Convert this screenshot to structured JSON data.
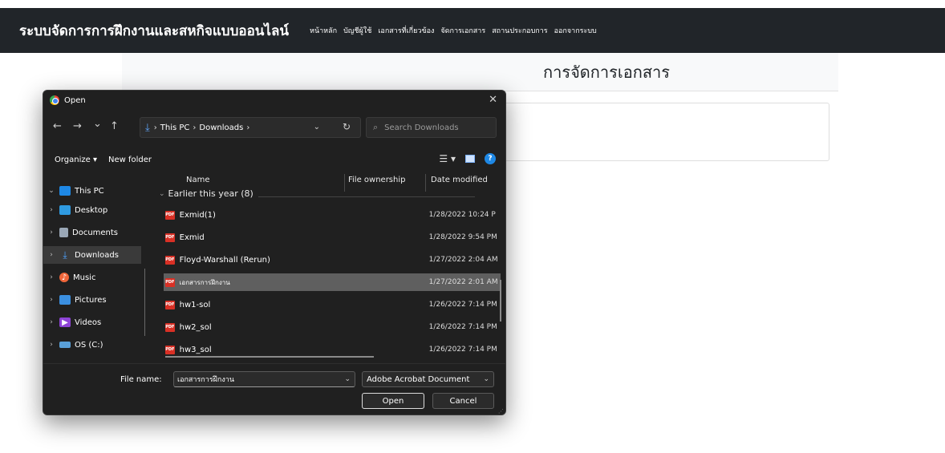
{
  "site": {
    "brand": "ระบบจัดการการฝึกงานและสหกิจแบบออนไลน์",
    "nav": [
      "หน้าหลัก",
      "บัญชีผู้ใช้",
      "เอกสารที่เกี่ยวข้อง",
      "จัดการเอกสาร",
      "สถานประกอบการ",
      "ออกจากระบบ"
    ],
    "page_title": "การจัดการเอกสาร"
  },
  "dialog": {
    "title": "Open",
    "back": "←",
    "forward": "→",
    "recent": "⌄",
    "up": "↑",
    "breadcrumb": [
      "This PC",
      "Downloads"
    ],
    "search_placeholder": "Search Downloads",
    "toolbar": {
      "organize": "Organize ▾",
      "new_folder": "New folder"
    },
    "nav_items": [
      {
        "label": "This PC",
        "icon": "pc-icon",
        "expanded": true
      },
      {
        "label": "Desktop",
        "icon": "desktop-icon"
      },
      {
        "label": "Documents",
        "icon": "documents-icon"
      },
      {
        "label": "Downloads",
        "icon": "download-icon",
        "selected": true
      },
      {
        "label": "Music",
        "icon": "music-icon"
      },
      {
        "label": "Pictures",
        "icon": "pictures-icon"
      },
      {
        "label": "Videos",
        "icon": "videos-icon"
      },
      {
        "label": "OS (C:)",
        "icon": "drive-icon"
      }
    ],
    "columns": {
      "name": "Name",
      "ownership": "File ownership",
      "modified": "Date modified"
    },
    "group": "Earlier this year (8)",
    "files": [
      {
        "name": "Exmid(1)",
        "date": "1/28/2022 10:24 P"
      },
      {
        "name": "Exmid",
        "date": "1/28/2022 9:54 PM"
      },
      {
        "name": "Floyd-Warshall (Rerun)",
        "date": "1/27/2022 2:04 AM"
      },
      {
        "name": "เอกสารการฝึกงาน",
        "date": "1/27/2022 2:01 AM",
        "selected": true
      },
      {
        "name": "hw1-sol",
        "date": "1/26/2022 7:14 PM"
      },
      {
        "name": "hw2_sol",
        "date": "1/26/2022 7:14 PM"
      },
      {
        "name": "hw3_sol",
        "date": "1/26/2022 7:14 PM"
      }
    ],
    "file_name_label": "File name:",
    "file_name_value": "เอกสารการฝึกงาน",
    "file_type": "Adobe Acrobat Document",
    "open_label": "Open",
    "cancel_label": "Cancel"
  }
}
